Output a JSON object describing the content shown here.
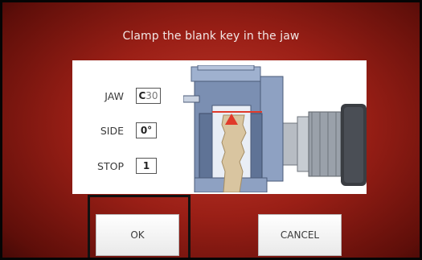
{
  "title": "Clamp the blank key in the jaw",
  "fields": {
    "jaw": {
      "label": "JAW",
      "prefix": "C",
      "number": "30"
    },
    "side": {
      "label": "SIDE",
      "value": "0°"
    },
    "stop": {
      "label": "STOP",
      "value": "1"
    }
  },
  "buttons": {
    "ok": "OK",
    "cancel": "CANCEL"
  },
  "colors": {
    "background": "#9a1f16",
    "panel": "#ffffff",
    "clamp": "#7b8fb2",
    "key": "#d9c5a0",
    "marker": "#e03a2a"
  },
  "icons": {
    "illustration": "key-clamp-illustration"
  }
}
